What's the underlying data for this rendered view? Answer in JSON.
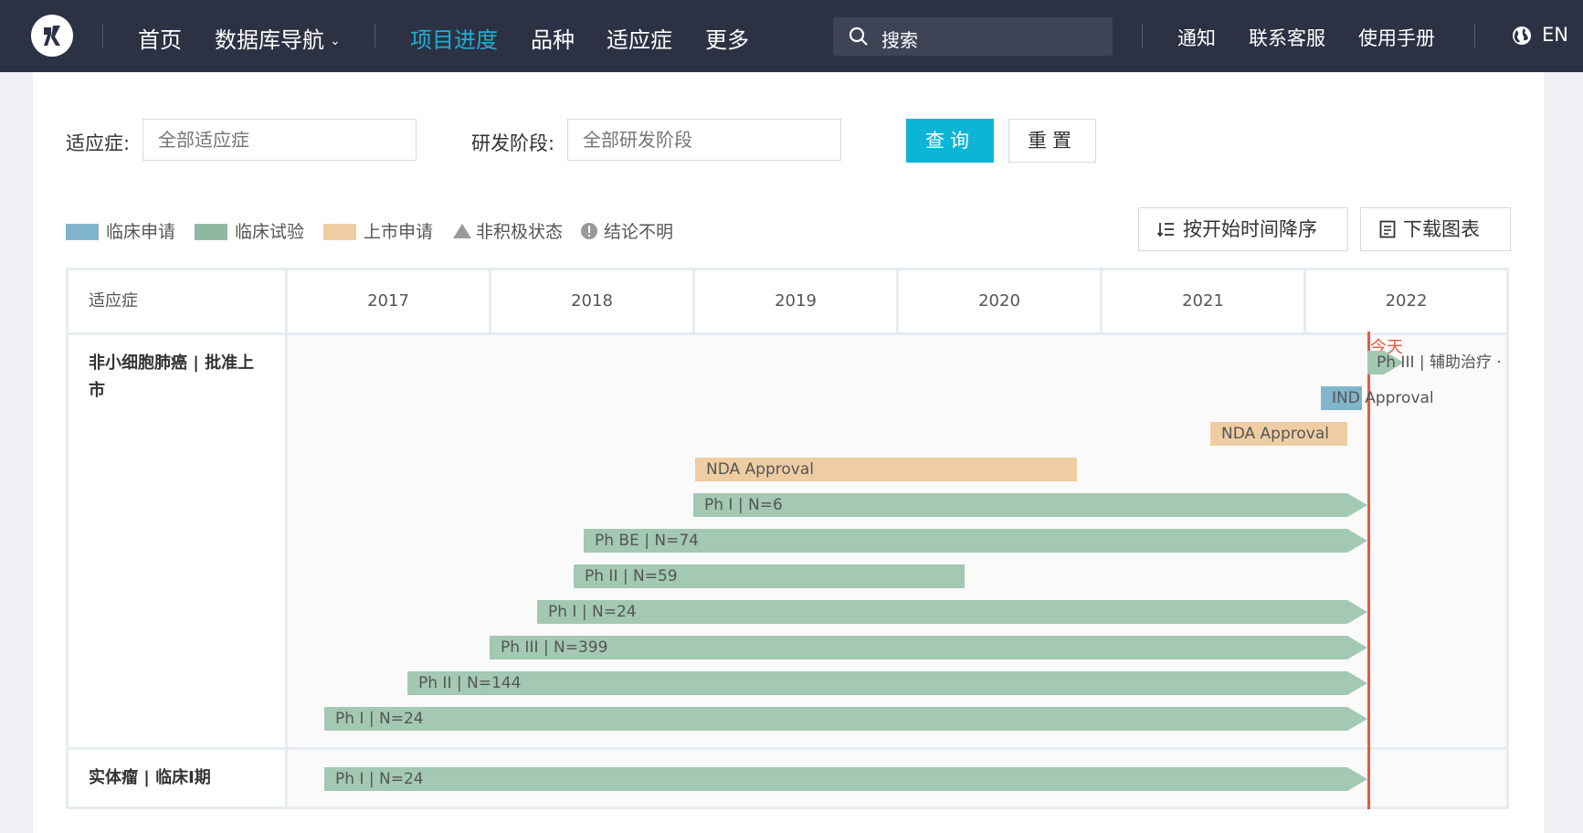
{
  "nav": {
    "items": [
      "首页",
      "数据库导航",
      "项目进度",
      "品种",
      "适应症",
      "更多"
    ],
    "search_placeholder": "搜索",
    "links": [
      "通知",
      "联系客服",
      "使用手册"
    ],
    "lang": "EN"
  },
  "filters": {
    "indication_label": "适应症:",
    "indication_placeholder": "全部适应症",
    "stage_label": "研发阶段:",
    "stage_placeholder": "全部研发阶段",
    "query_button": "查询",
    "reset_button": "重置"
  },
  "legend": [
    {
      "label": "临床申请",
      "color": "#80b5cc"
    },
    {
      "label": "临床试验",
      "color": "#8fb8a0"
    },
    {
      "label": "上市申请",
      "color": "#efcda3"
    },
    {
      "label": "非积极状态",
      "icon": "triangle-icon"
    },
    {
      "label": "结论不明",
      "icon": "exclamation-circle-icon"
    }
  ],
  "tools": {
    "sort_label": "按开始时间降序",
    "download_label": "下载图表"
  },
  "gantt": {
    "indication_header": "适应症",
    "years": [
      "2017",
      "2018",
      "2019",
      "2020",
      "2021",
      "2022"
    ],
    "today_label": "今天",
    "rows": [
      {
        "label": "非小细胞肺癌 | 批准上市",
        "bars": [
          {
            "text": "Ph III | 辅助治疗 ·",
            "type": "trial"
          },
          {
            "text": "IND Approval",
            "type": "ind"
          },
          {
            "text": "NDA Approval",
            "type": "nda"
          },
          {
            "text": "NDA Approval",
            "type": "nda"
          },
          {
            "text": "Ph I | N=6",
            "type": "trial"
          },
          {
            "text": "Ph BE | N=74",
            "type": "trial"
          },
          {
            "text": "Ph II | N=59",
            "type": "trial"
          },
          {
            "text": "Ph I | N=24",
            "type": "trial"
          },
          {
            "text": "Ph III | N=399",
            "type": "trial"
          },
          {
            "text": "Ph II | N=144",
            "type": "trial"
          },
          {
            "text": "Ph I | N=24",
            "type": "trial"
          }
        ]
      },
      {
        "label": "实体瘤 | 临床I期",
        "bars": [
          {
            "text": "Ph I | N=24",
            "type": "trial"
          }
        ]
      }
    ]
  },
  "colors": {
    "nav_bg": "#2d3144",
    "accent": "#0cb5d5",
    "today": "#e55a3c",
    "trial": "#a3c8b3",
    "ind": "#80b5cc",
    "nda": "#efcda3"
  }
}
